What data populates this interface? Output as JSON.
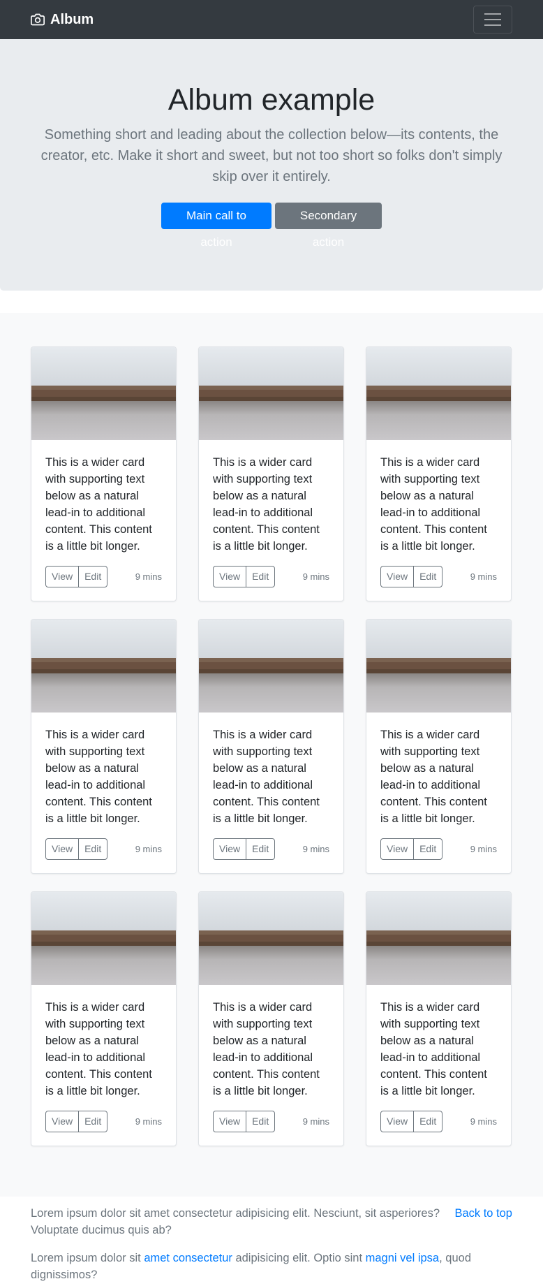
{
  "navbar": {
    "brand": "Album",
    "brand_icon": "camera-icon",
    "toggler_icon": "hamburger-icon"
  },
  "hero": {
    "title": "Album example",
    "lead": "Something short and leading about the collection below—its contents, the creator, etc. Make it short and sweet, but not too short so folks don't simply skip over it entirely.",
    "primary_cta": "Main call to action",
    "secondary_cta": "Secondary action"
  },
  "colors": {
    "navbar": "#343a40",
    "hero_bg": "#e9ecef",
    "primary": "#007bff",
    "secondary": "#6c757d",
    "album_bg": "#f8f9fa"
  },
  "cards": [
    {
      "text": "This is a wider card with supporting text below as a natural lead-in to additional content. This content is a little bit longer.",
      "view": "View",
      "edit": "Edit",
      "time": "9 mins"
    },
    {
      "text": "This is a wider card with supporting text below as a natural lead-in to additional content. This content is a little bit longer.",
      "view": "View",
      "edit": "Edit",
      "time": "9 mins"
    },
    {
      "text": "This is a wider card with supporting text below as a natural lead-in to additional content. This content is a little bit longer.",
      "view": "View",
      "edit": "Edit",
      "time": "9 mins"
    },
    {
      "text": "This is a wider card with supporting text below as a natural lead-in to additional content. This content is a little bit longer.",
      "view": "View",
      "edit": "Edit",
      "time": "9 mins"
    },
    {
      "text": "This is a wider card with supporting text below as a natural lead-in to additional content. This content is a little bit longer.",
      "view": "View",
      "edit": "Edit",
      "time": "9 mins"
    },
    {
      "text": "This is a wider card with supporting text below as a natural lead-in to additional content. This content is a little bit longer.",
      "view": "View",
      "edit": "Edit",
      "time": "9 mins"
    },
    {
      "text": "This is a wider card with supporting text below as a natural lead-in to additional content. This content is a little bit longer.",
      "view": "View",
      "edit": "Edit",
      "time": "9 mins"
    },
    {
      "text": "This is a wider card with supporting text below as a natural lead-in to additional content. This content is a little bit longer.",
      "view": "View",
      "edit": "Edit",
      "time": "9 mins"
    },
    {
      "text": "This is a wider card with supporting text below as a natural lead-in to additional content. This content is a little bit longer.",
      "view": "View",
      "edit": "Edit",
      "time": "9 mins"
    }
  ],
  "footer": {
    "back_to_top": "Back to top",
    "line1": "Lorem ipsum dolor sit amet consectetur adipisicing elit. Nesciunt, sit asperiores? Voluptate ducimus quis ab?",
    "line2_a": "Lorem ipsum dolor sit ",
    "line2_link1": "amet consectetur",
    "line2_b": " adipisicing elit. Optio sint ",
    "line2_link2": "magni vel ipsa",
    "line2_c": ", quod dignissimos?"
  }
}
